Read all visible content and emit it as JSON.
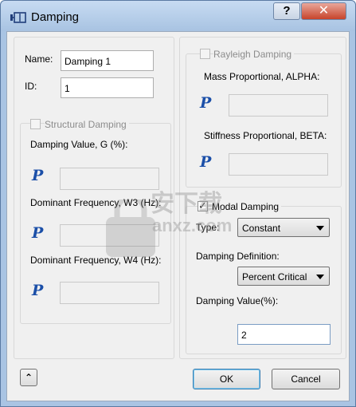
{
  "window": {
    "title": "Damping",
    "help_label": "?",
    "close_label": "✕"
  },
  "left": {
    "name_label": "Name:",
    "name_value": "Damping 1",
    "id_label": "ID:",
    "id_value": "1",
    "structural_checkbox_label": "Structural Damping",
    "structural_checked": false,
    "damping_value_label": "Damping Value, G (%):",
    "w3_label": "Dominant Frequency, W3 (Hz):",
    "w4_label": "Dominant Frequency, W4 (Hz):",
    "p_symbol": "P"
  },
  "right": {
    "rayleigh_checkbox_label": "Rayleigh Damping",
    "rayleigh_checked": false,
    "alpha_label": "Mass Proportional, ALPHA:",
    "beta_label": "Stiffness Proportional, BETA:",
    "modal_checkbox_label": "Modal Damping",
    "modal_checked": true,
    "type_label": "Type:",
    "type_value": "Constant",
    "definition_label": "Damping Definition:",
    "definition_value": "Percent Critical",
    "value_label": "Damping Value(%):",
    "value_value": "2"
  },
  "footer": {
    "expand_label": "⌃",
    "ok_label": "OK",
    "cancel_label": "Cancel"
  },
  "watermark": {
    "cn_text": "安下载",
    "en_text": "anxz.com"
  }
}
